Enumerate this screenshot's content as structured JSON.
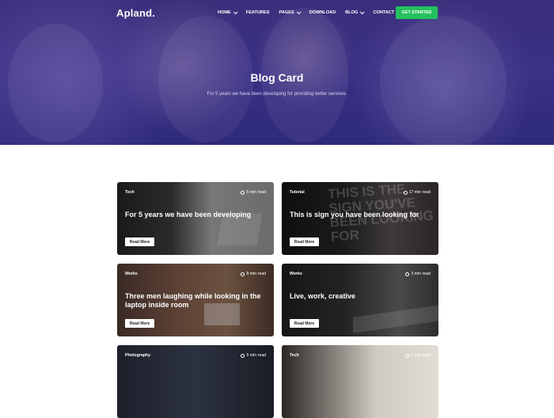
{
  "brand": "Apland.",
  "nav": [
    {
      "label": "HOME",
      "dropdown": true
    },
    {
      "label": "FEATURES",
      "dropdown": false
    },
    {
      "label": "PAGES",
      "dropdown": true
    },
    {
      "label": "DOWNLOAD",
      "dropdown": false
    },
    {
      "label": "BLOG",
      "dropdown": true
    },
    {
      "label": "CONTACT",
      "dropdown": false
    }
  ],
  "cta_label": "GET STARTED",
  "hero": {
    "title": "Blog Card",
    "subtitle": "For 5 years we have been developing for providing better services."
  },
  "cards": [
    {
      "tag": "Tech",
      "read_time": "5 min read",
      "title": "For 5 years we have been developing",
      "button": "Read More"
    },
    {
      "tag": "Tutorial",
      "read_time": "17 min read",
      "title": "This is sign you have been looking for",
      "button": "Read More"
    },
    {
      "tag": "Works",
      "read_time": "8 min read",
      "title": "Three men laughing while looking in the laptop inside room",
      "button": "Read More"
    },
    {
      "tag": "Works",
      "read_time": "3 min read",
      "title": "Live, work, creative",
      "button": "Read More"
    },
    {
      "tag": "Photography",
      "read_time": "6 min read",
      "title": "",
      "button": ""
    },
    {
      "tag": "Tech",
      "read_time": "5 min read",
      "title": "",
      "button": ""
    }
  ],
  "neon_text": "THIS IS THE SIGN YOU'VE BEEN LOOKING FOR",
  "colors": {
    "hero": "#3a3085",
    "cta": "#24c25e",
    "page_bg": "#ffffff"
  }
}
